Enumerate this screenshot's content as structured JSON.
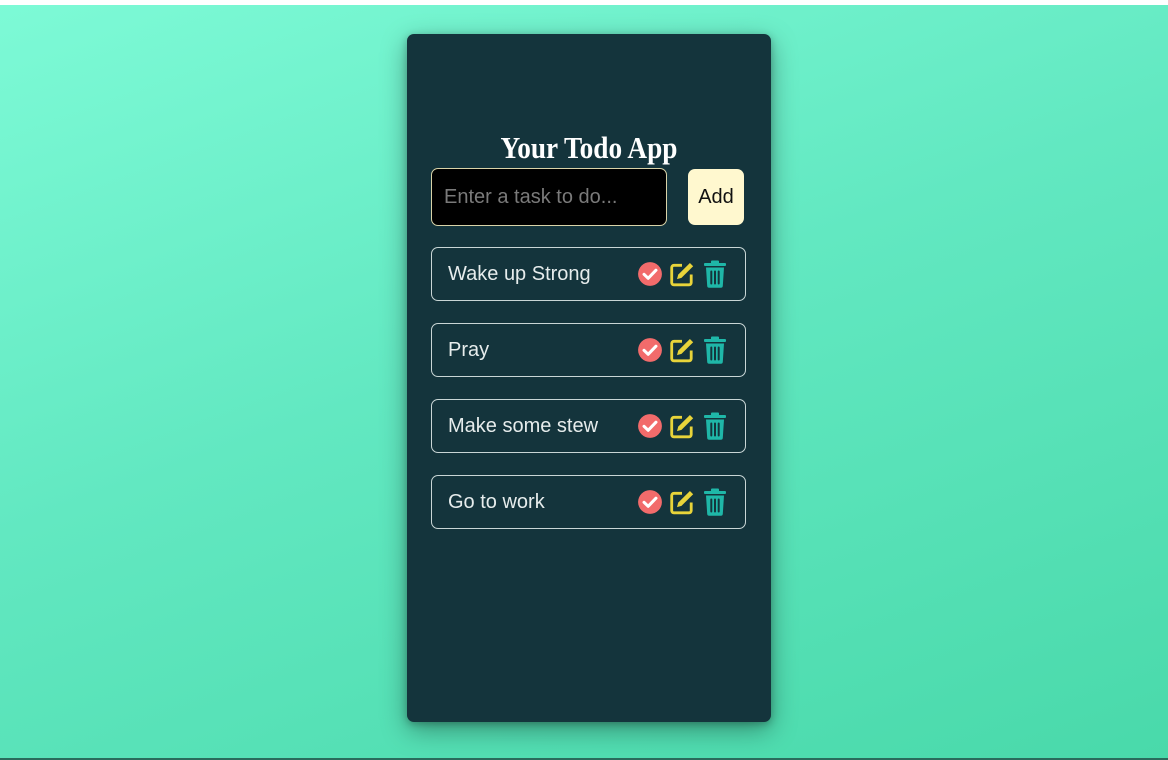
{
  "app": {
    "title": "Your Todo App"
  },
  "input": {
    "placeholder": "Enter a task to do...",
    "value": ""
  },
  "add_button": {
    "label": "Add"
  },
  "todos": [
    {
      "text": "Wake up Strong",
      "complete_icon": "check-circle-icon",
      "edit_icon": "edit-icon",
      "delete_icon": "trash-icon"
    },
    {
      "text": "Pray",
      "complete_icon": "check-circle-icon",
      "edit_icon": "edit-icon",
      "delete_icon": "trash-icon"
    },
    {
      "text": "Make some stew",
      "complete_icon": "check-circle-icon",
      "edit_icon": "edit-icon",
      "delete_icon": "trash-icon"
    },
    {
      "text": "Go to work",
      "complete_icon": "check-circle-icon",
      "edit_icon": "edit-icon",
      "delete_icon": "trash-icon"
    }
  ],
  "colors": {
    "background_gradient_start": "#7dfad6",
    "background_gradient_end": "#49d9aa",
    "card": "#14343c",
    "check_icon": "#f26b6b",
    "edit_icon": "#e8d43a",
    "trash_icon": "#1fb7a8",
    "add_button": "#fff8cf"
  }
}
